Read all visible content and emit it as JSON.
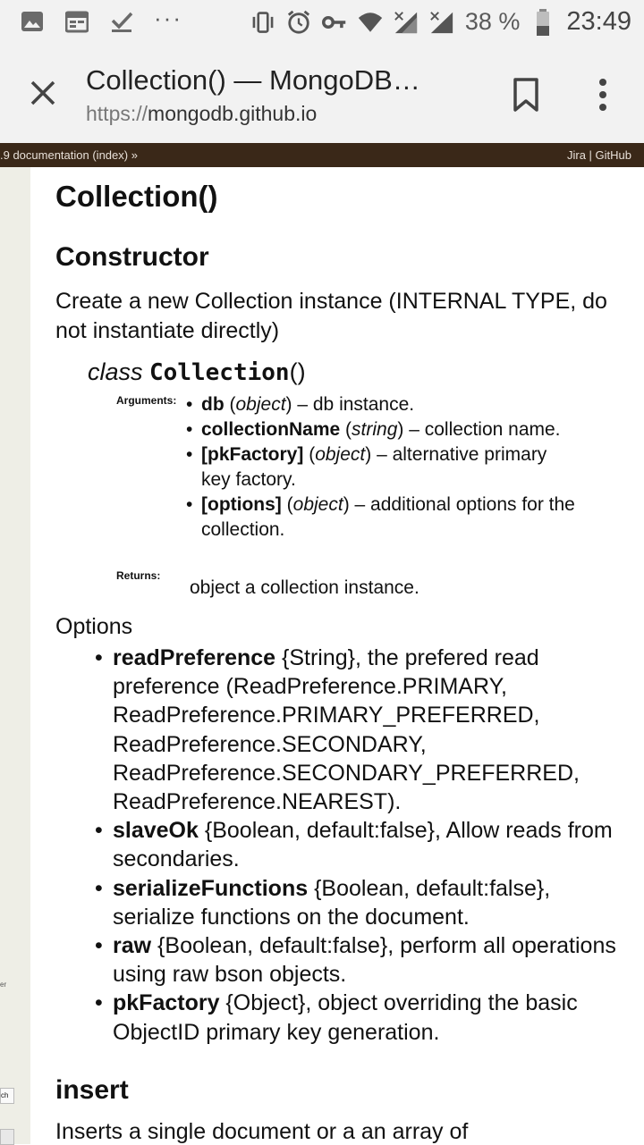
{
  "status_bar": {
    "battery": "38 %",
    "time": "23:49",
    "more": "···",
    "icons": [
      "image-icon",
      "calendar-icon",
      "check-icon",
      "vibrate-icon",
      "alarm-icon",
      "key-icon",
      "wifi-icon",
      "signal-x-icon",
      "signal-x-icon",
      "battery-icon"
    ]
  },
  "toolbar": {
    "title": "Collection() — MongoDB…",
    "url_scheme": "https://",
    "url_host": "mongodb.github.io"
  },
  "docbar": {
    "left": ".9 documentation (index) »",
    "right": "Jira | GitHub"
  },
  "side": {
    "frag1": "er",
    "frag2": "ch"
  },
  "doc": {
    "title": "Collection()",
    "constructor_heading": "Constructor",
    "constructor_desc": "Create a new Collection instance (INTERNAL TYPE, do not instantiate directly)",
    "sig_keyword": "class",
    "sig_name": "Collection",
    "sig_parens": "()",
    "arguments_label": "Arguments:",
    "arguments": [
      {
        "name": "db",
        "type": "object",
        "desc": " – db instance."
      },
      {
        "name": "collectionName",
        "type": "string",
        "desc": " – collection name."
      },
      {
        "name": "[pkFactory]",
        "type": "object",
        "desc": " – alternative primary key factory."
      },
      {
        "name": "[options]",
        "type": "object",
        "desc": " – additional options for the collection."
      }
    ],
    "returns_label": "Returns:",
    "returns": "object a collection instance.",
    "options_title": "Options",
    "options": [
      {
        "name": "readPreference",
        "desc": " {String}, the prefered read preference (ReadPreference.PRIMARY, ReadPreference.PRIMARY_PREFERRED, ReadPreference.SECONDARY, ReadPreference.SECONDARY_PREFERRED, ReadPreference.NEAREST)."
      },
      {
        "name": "slaveOk",
        "desc": " {Boolean, default:false}, Allow reads from secondaries."
      },
      {
        "name": "serializeFunctions",
        "desc": " {Boolean, default:false}, serialize functions on the document."
      },
      {
        "name": "raw",
        "desc": " {Boolean, default:false}, perform all operations using raw bson objects."
      },
      {
        "name": "pkFactory",
        "desc": " {Object}, object overriding the basic ObjectID primary key generation."
      }
    ],
    "insert_heading": "insert",
    "insert_desc": "Inserts a single document or a an array of"
  }
}
